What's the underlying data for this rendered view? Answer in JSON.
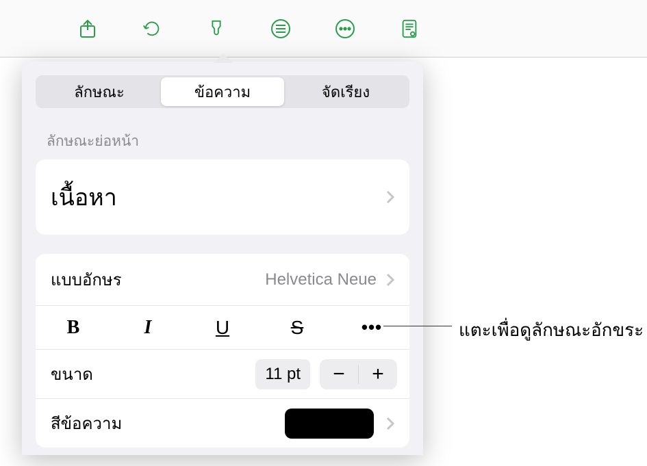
{
  "toolbar": {
    "icons": [
      "share-icon",
      "undo-icon",
      "brush-icon",
      "style-list-icon",
      "more-icon",
      "document-view-icon"
    ]
  },
  "tabs": {
    "items": [
      {
        "label": "ลักษณะ",
        "active": false
      },
      {
        "label": "ข้อความ",
        "active": true
      },
      {
        "label": "จัดเรียง",
        "active": false
      }
    ]
  },
  "paragraph_style": {
    "section_label": "ลักษณะย่อหน้า",
    "value": "เนื้อหา"
  },
  "font": {
    "label": "แบบอักษร",
    "value": "Helvetica Neue"
  },
  "format_buttons": {
    "bold": "B",
    "italic": "I",
    "underline": "U",
    "strike": "S",
    "more": "•••"
  },
  "size": {
    "label": "ขนาด",
    "value": "11 pt",
    "minus": "−",
    "plus": "+"
  },
  "text_color": {
    "label": "สีข้อความ",
    "swatch": "#000000"
  },
  "annotation": {
    "text": "แตะเพื่อดูลักษณะอักขระ"
  }
}
